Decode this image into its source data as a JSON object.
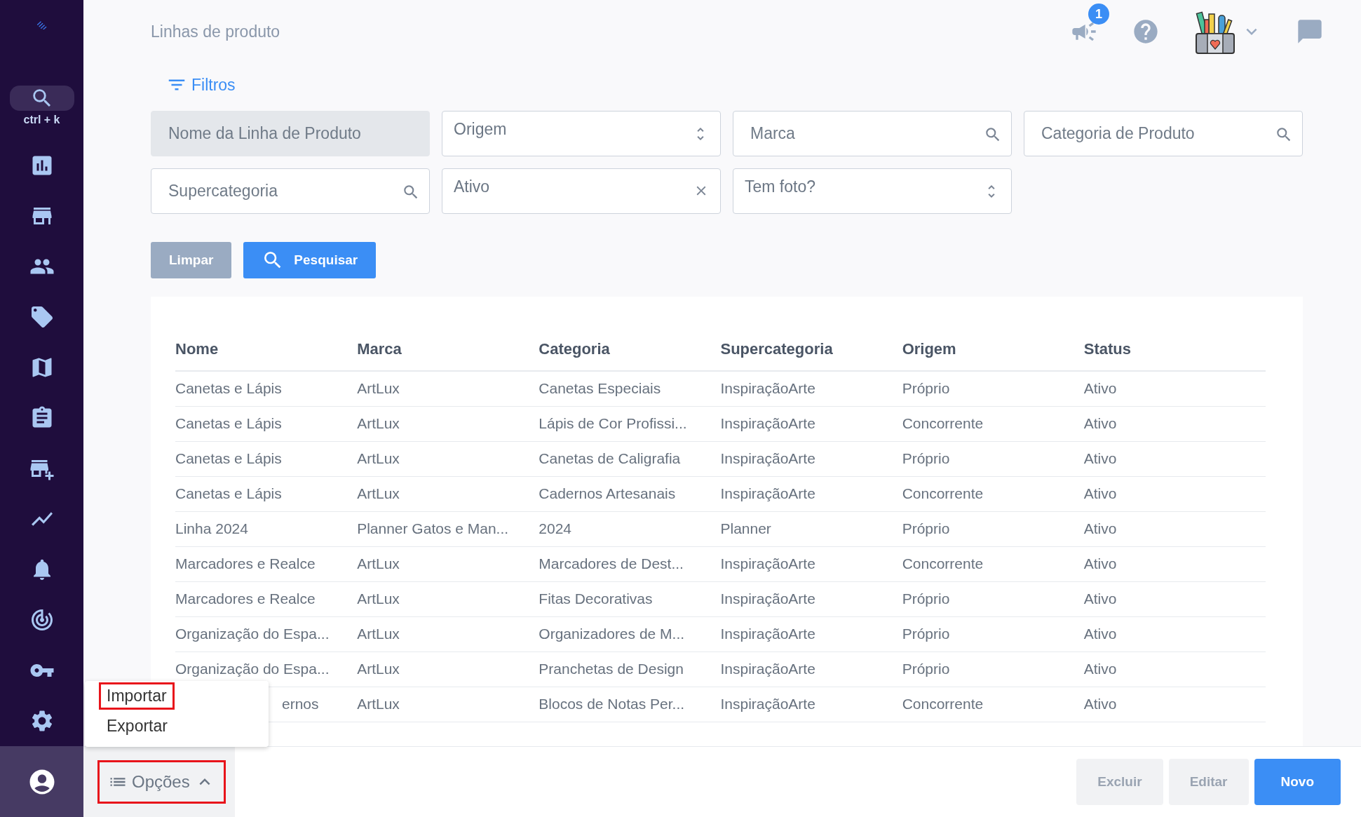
{
  "sidebar": {
    "search_shortcut": "ctrl + k"
  },
  "header": {
    "title": "Linhas de produto",
    "notification_count": "1"
  },
  "filters": {
    "title": "Filtros",
    "fields": [
      {
        "kind": "text",
        "placeholder": "Nome da Linha de Produto",
        "disabled": true
      },
      {
        "kind": "select",
        "value": "Origem",
        "disabled": false
      },
      {
        "kind": "search",
        "placeholder": "Marca",
        "disabled": false
      },
      {
        "kind": "search",
        "placeholder": "Categoria de Produto",
        "disabled": false
      },
      {
        "kind": "search",
        "placeholder": "Supercategoria",
        "disabled": false
      },
      {
        "kind": "clearable",
        "value": "Ativo",
        "disabled": false
      },
      {
        "kind": "select",
        "value": "Tem foto?",
        "disabled": false
      }
    ],
    "buttons": [
      {
        "label": "Limpar",
        "kind": "secondary"
      },
      {
        "label": "Pesquisar",
        "kind": "primary"
      }
    ]
  },
  "table": {
    "columns": [
      "Nome",
      "Marca",
      "Categoria",
      "Supercategoria",
      "Origem",
      "Status"
    ],
    "rows": [
      {
        "cells": [
          "Canetas e Lápis",
          "ArtLux",
          "Canetas Especiais",
          "InspiraçãoArte",
          "Próprio",
          "Ativo"
        ],
        "first_cell_covered": false
      },
      {
        "cells": [
          "Canetas e Lápis",
          "ArtLux",
          "Lápis de Cor Profissi...",
          "InspiraçãoArte",
          "Concorrente",
          "Ativo"
        ],
        "first_cell_covered": false
      },
      {
        "cells": [
          "Canetas e Lápis",
          "ArtLux",
          "Canetas de Caligrafia",
          "InspiraçãoArte",
          "Próprio",
          "Ativo"
        ],
        "first_cell_covered": false
      },
      {
        "cells": [
          "Canetas e Lápis",
          "ArtLux",
          "Cadernos Artesanais",
          "InspiraçãoArte",
          "Concorrente",
          "Ativo"
        ],
        "first_cell_covered": false
      },
      {
        "cells": [
          "Linha 2024",
          "Planner Gatos e Man...",
          "2024",
          "Planner",
          "Próprio",
          "Ativo"
        ],
        "first_cell_covered": false
      },
      {
        "cells": [
          "Marcadores e Realce",
          "ArtLux",
          "Marcadores de Dest...",
          "InspiraçãoArte",
          "Concorrente",
          "Ativo"
        ],
        "first_cell_covered": false
      },
      {
        "cells": [
          "Marcadores e Realce",
          "ArtLux",
          "Fitas Decorativas",
          "InspiraçãoArte",
          "Próprio",
          "Ativo"
        ],
        "first_cell_covered": false
      },
      {
        "cells": [
          "Organização do Espa...",
          "ArtLux",
          "Organizadores de M...",
          "InspiraçãoArte",
          "Próprio",
          "Ativo"
        ],
        "first_cell_covered": false
      },
      {
        "cells": [
          "Organização do Espa...",
          "ArtLux",
          "Pranchetas de Design",
          "InspiraçãoArte",
          "Próprio",
          "Ativo"
        ],
        "first_cell_covered": false
      },
      {
        "cells": [
          "ernos",
          "ArtLux",
          "Blocos de Notas Per...",
          "InspiraçãoArte",
          "Concorrente",
          "Ativo"
        ],
        "first_cell_covered": true
      }
    ]
  },
  "options_menu": {
    "items": [
      {
        "label": "Importar",
        "highlighted": true
      },
      {
        "label": "Exportar",
        "highlighted": false
      }
    ]
  },
  "options_button": {
    "label": "Opções",
    "expanded": true,
    "highlighted": true
  },
  "actions": [
    {
      "label": "Excluir",
      "disabled": true
    },
    {
      "label": "Editar",
      "disabled": true
    },
    {
      "label": "Novo",
      "disabled": false
    }
  ]
}
